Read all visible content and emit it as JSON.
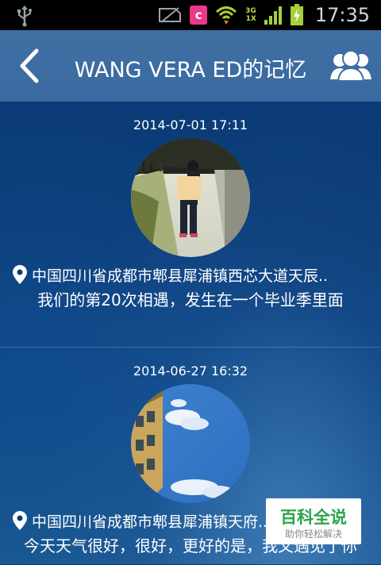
{
  "status_bar": {
    "time": "17:35",
    "app_badge": "c",
    "network_3g": "3G",
    "network_1x": "1X",
    "icons": [
      "usb-icon",
      "no-sim-icon",
      "c-app-icon",
      "wifi-icon",
      "signal-icon",
      "battery-charging-icon"
    ]
  },
  "header": {
    "title": "WANG VERA ED的记忆",
    "back_icon": "chevron-left-icon",
    "friends_icon": "people-group-icon"
  },
  "entries": [
    {
      "date": "2014-07-01 17:11",
      "location": "中国四川省成都市郫县犀浦镇西芯大道天辰..",
      "text": "我们的第20次相遇，发生在一个毕业季里面"
    },
    {
      "date": "2014-06-27 16:32",
      "location": "中国四川省成都市郫县犀浦镇天府..",
      "text": "今天天气很好，很好，更好的是，我又遇见了你"
    }
  ],
  "watermark": {
    "title": "百科全说",
    "subtitle": "助你轻松解决"
  },
  "colors": {
    "header_bg": "#3f6fa3",
    "background": "#0b3d78",
    "watermark_green": "#2aa54a"
  }
}
